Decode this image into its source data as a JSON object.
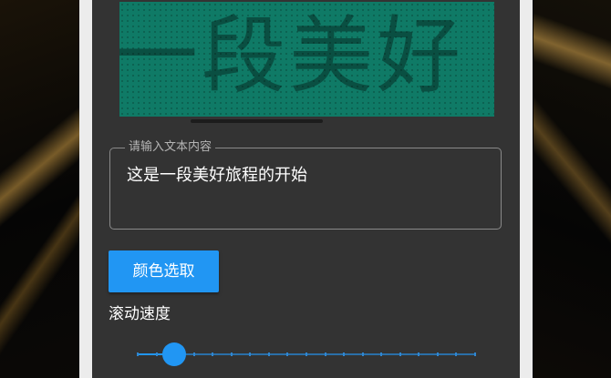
{
  "preview": {
    "display_text": "一段美好",
    "background_color": "#0f7a66",
    "text_color": "#0a4f42"
  },
  "text_input": {
    "label": "请输入文本内容",
    "value": "这是一段美好旅程的开始"
  },
  "color_picker": {
    "label": "颜色选取",
    "color": "#2196f3"
  },
  "speed": {
    "label": "滚动速度",
    "value_fraction": 0.11,
    "tick_count": 18
  }
}
